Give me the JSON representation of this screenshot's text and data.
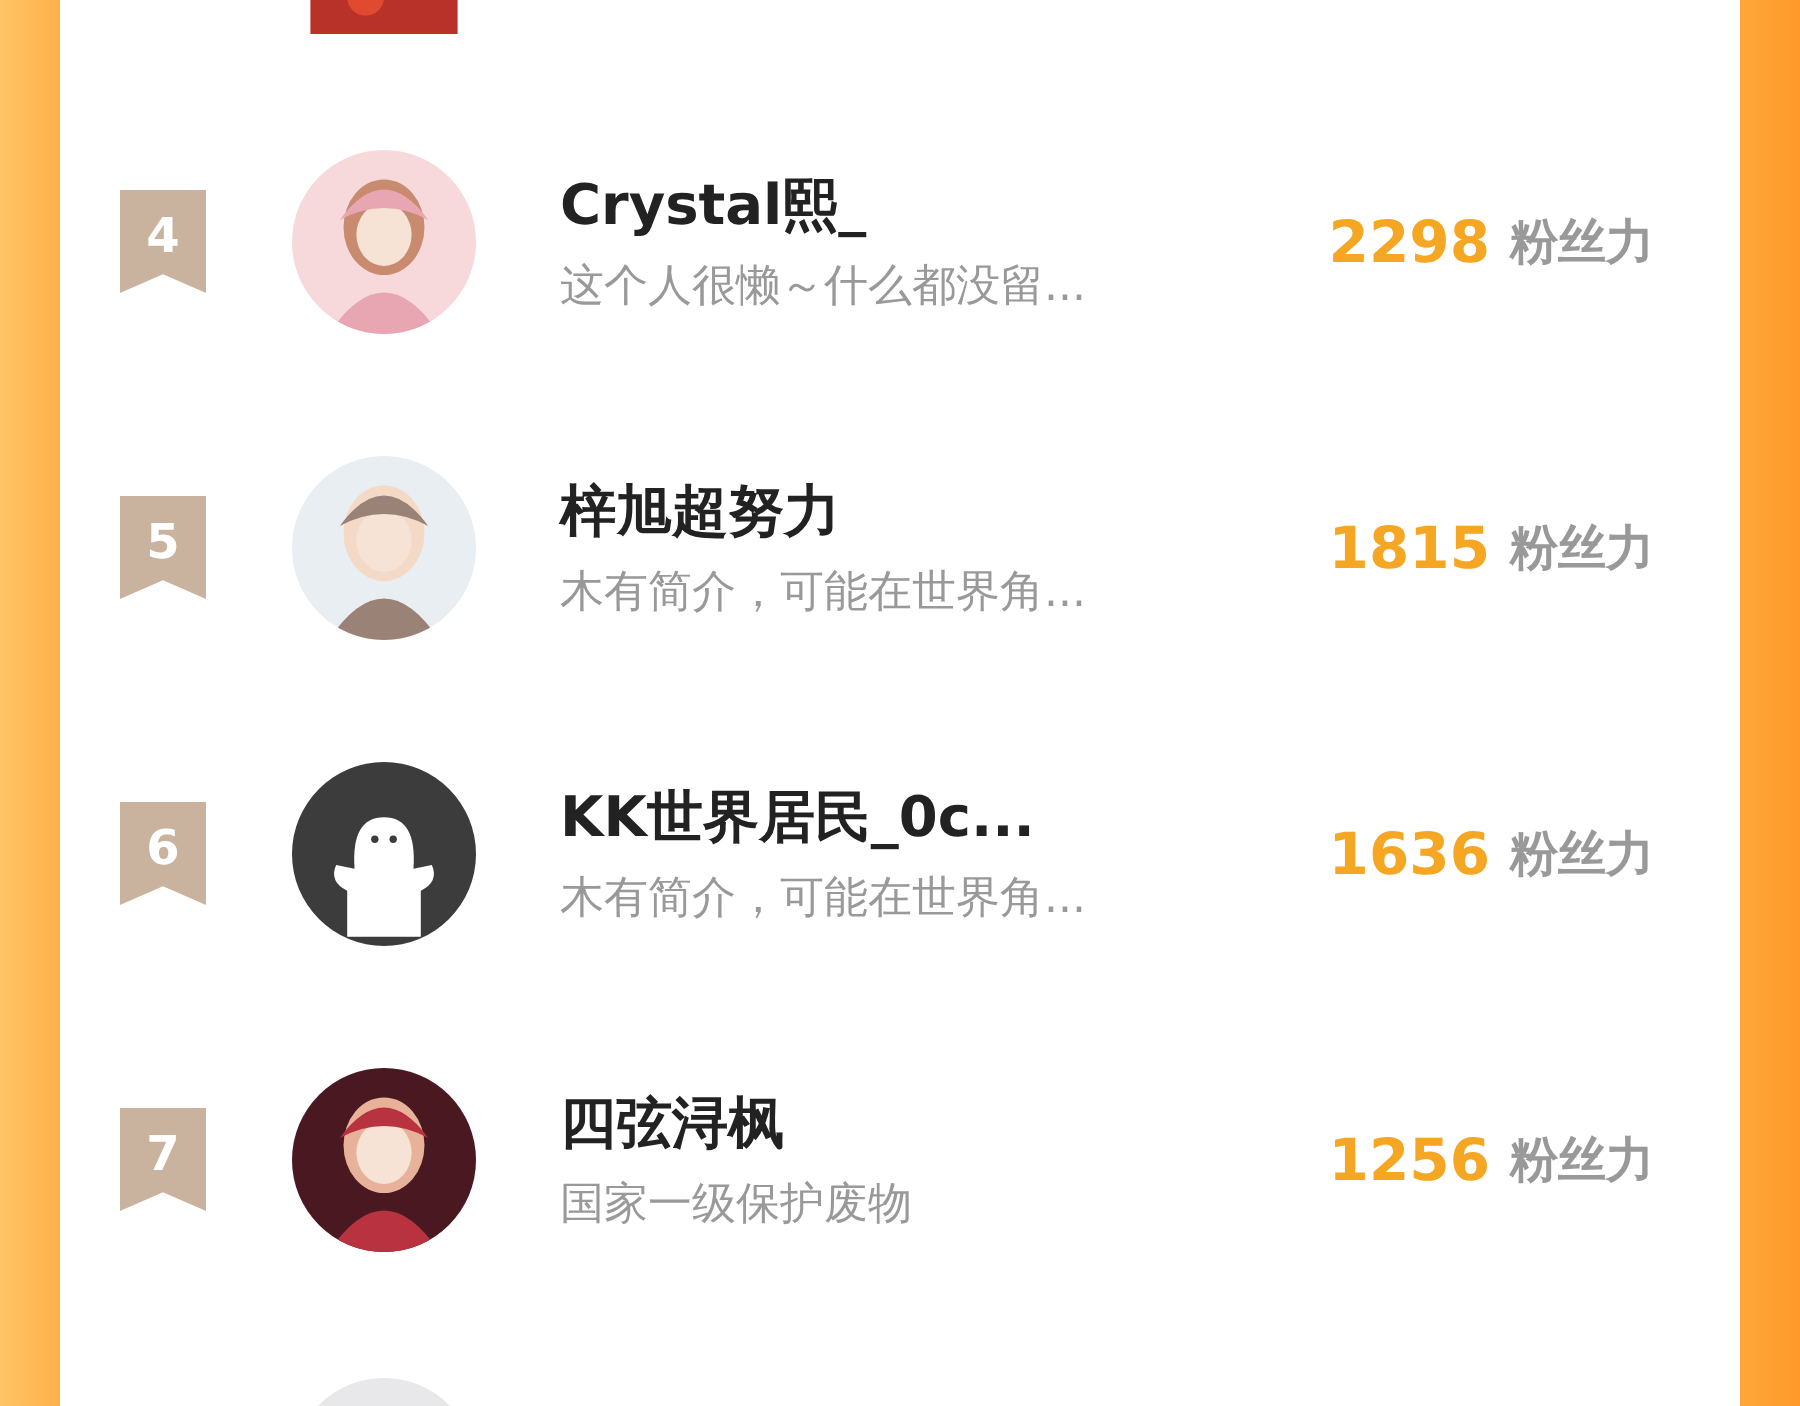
{
  "rows": [
    {
      "rank": "4",
      "name": "Crystal熙_",
      "bio": "这个人很懒～什么都没留...",
      "score": "2298",
      "unit": "粉丝力"
    },
    {
      "rank": "5",
      "name": "梓旭超努力",
      "bio": "木有简介，可能在世界角...",
      "score": "1815",
      "unit": "粉丝力"
    },
    {
      "rank": "6",
      "avatar": {
        "kind": "default"
      },
      "name": "KK世界居民_0c...",
      "bio": "木有简介，可能在世界角...",
      "score": "1636",
      "unit": "粉丝力"
    },
    {
      "rank": "7",
      "name": "四弦浔枫",
      "bio": "国家一级保护废物",
      "score": "1256",
      "unit": "粉丝力"
    }
  ]
}
